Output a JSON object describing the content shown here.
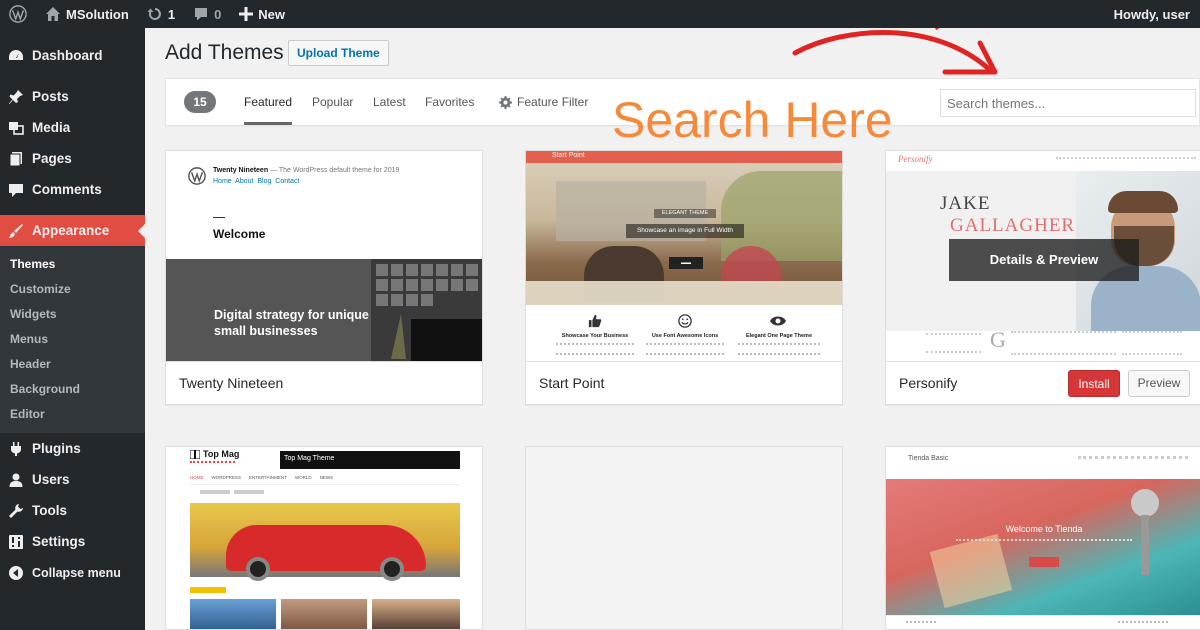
{
  "adminbar": {
    "site_name": "MSolution",
    "updates_count": "1",
    "comments_count": "0",
    "new_label": "New",
    "howdy": "Howdy, user"
  },
  "sidebar": {
    "items": [
      {
        "label": "Dashboard",
        "icon": "dashboard-icon"
      },
      {
        "label": "Posts",
        "icon": "pin-icon"
      },
      {
        "label": "Media",
        "icon": "media-icon"
      },
      {
        "label": "Pages",
        "icon": "pages-icon"
      },
      {
        "label": "Comments",
        "icon": "comment-icon"
      },
      {
        "label": "Appearance",
        "icon": "brush-icon"
      },
      {
        "label": "Plugins",
        "icon": "plugin-icon"
      },
      {
        "label": "Users",
        "icon": "user-icon"
      },
      {
        "label": "Tools",
        "icon": "wrench-icon"
      },
      {
        "label": "Settings",
        "icon": "settings-icon"
      },
      {
        "label": "Collapse menu",
        "icon": "collapse-icon"
      }
    ],
    "appearance_submenu": [
      "Themes",
      "Customize",
      "Widgets",
      "Menus",
      "Header",
      "Background",
      "Editor"
    ]
  },
  "page": {
    "title": "Add Themes",
    "upload_button": "Upload Theme"
  },
  "filter": {
    "count": "15",
    "tabs": [
      "Featured",
      "Popular",
      "Latest",
      "Favorites"
    ],
    "feature_filter": "Feature Filter",
    "search_placeholder": "Search themes..."
  },
  "annotation": {
    "text": "Search Here",
    "color": "#f58a3d",
    "arrow_color": "#e02424"
  },
  "themes": [
    {
      "name": "Twenty Nineteen",
      "preview_site": "Twenty Nineteen",
      "preview_tagline": "— The WordPress default theme for 2019",
      "preview_nav": "Home  About  Blog  Contact",
      "preview_heading": "Welcome",
      "preview_banner": "Digital strategy for unique small businesses"
    },
    {
      "name": "Start Point",
      "preview_site": "Start Point",
      "preview_badge": "ELEGANT THEME",
      "preview_caption": "Showcase an image in Full Width",
      "preview_features": [
        "Showcase Your Business",
        "Use Font Awesome Icons",
        "Elegant One Page Theme"
      ]
    },
    {
      "name": "Personify",
      "preview_site": "Personify",
      "preview_name_line1": "JAKE",
      "preview_name_line2": "GALLAGHER",
      "overlay_label": "Details & Preview",
      "install_label": "Install",
      "preview_label": "Preview"
    },
    {
      "name": "",
      "preview_site": "Top Mag",
      "preview_tagline": "Top Mag Theme",
      "preview_menu": [
        "HOME",
        "WORDPRESS",
        "ENTERTAINMENT",
        "WORLD",
        "NEWS"
      ]
    },
    {
      "name": "",
      "preview_site": ""
    },
    {
      "name": "",
      "preview_site": "Tienda Basic",
      "preview_heading": "Welcome to Tienda"
    }
  ]
}
